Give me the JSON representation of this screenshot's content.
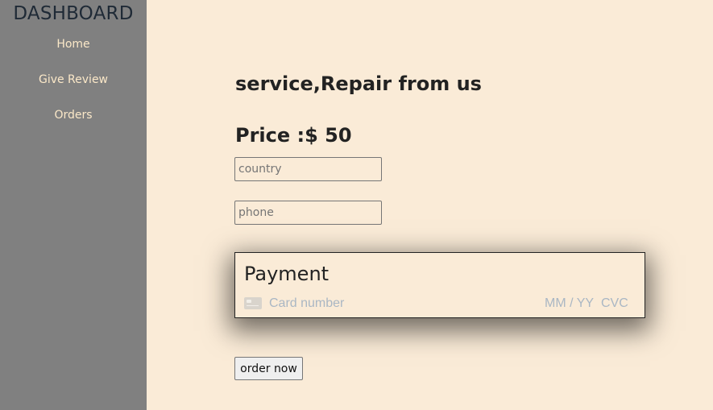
{
  "sidebar": {
    "title": "DASHBOARD",
    "items": [
      {
        "label": "Home"
      },
      {
        "label": "Give Review"
      },
      {
        "label": "Orders"
      }
    ]
  },
  "main": {
    "service_title": "service,Repair from us",
    "price": "Price :$ 50",
    "country_placeholder": "country",
    "phone_placeholder": "phone",
    "payment": {
      "title": "Payment",
      "card_placeholder": "Card number",
      "expiry_placeholder": "MM / YY",
      "cvc_placeholder": "CVC",
      "card_icon": "credit-card-icon"
    },
    "order_button": "order now"
  },
  "colors": {
    "background": "#faebd7",
    "sidebar": "#808080",
    "nav_text": "#fbe8c8",
    "card_placeholder": "#aab7c4"
  }
}
